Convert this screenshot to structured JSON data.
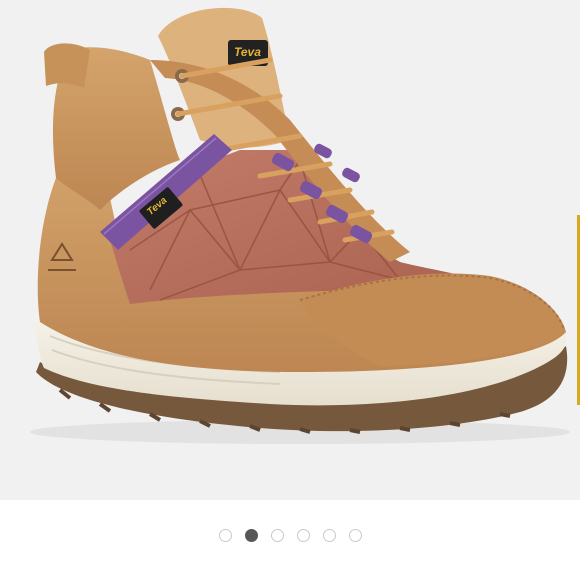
{
  "gallery": {
    "brand_logo_text": "Teva",
    "active_slide": 2,
    "slides": [
      {
        "active": false
      },
      {
        "active": true
      },
      {
        "active": false
      },
      {
        "active": false
      },
      {
        "active": false
      },
      {
        "active": false
      }
    ]
  },
  "colors": {
    "background": "#f1f1f1",
    "suede": "#c8935b",
    "quilted_nylon": "#b66f5e",
    "webbing": "#7b54a1",
    "sole": "#efe9dc",
    "outsole": "#76593d",
    "active_dot": "#575757",
    "inactive_dot_border": "#c9c9c9"
  }
}
